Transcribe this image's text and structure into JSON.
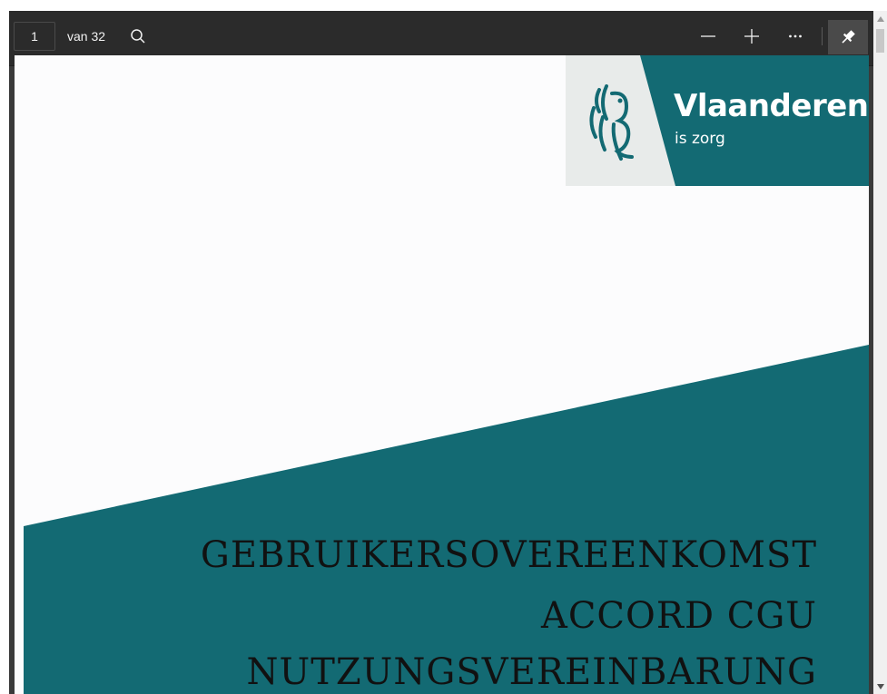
{
  "toolbar": {
    "page_number": "1",
    "page_total": "van 32",
    "icons": [
      "search-icon",
      "minus-icon",
      "plus-icon",
      "more-icon",
      "pin-icon"
    ]
  },
  "document": {
    "brand": {
      "wordmark": "Vlaanderen",
      "tagline": "is zorg",
      "color": "#136a73"
    },
    "title_lines": [
      "GEBRUIKERSOVEREENKOMST",
      "ACCORD CGU",
      "NUTZUNGSVEREINBARUNG"
    ]
  },
  "colors": {
    "toolbar_bg": "#2b2b2b",
    "teal": "#136a73",
    "logo_grey": "#e8ebea"
  }
}
